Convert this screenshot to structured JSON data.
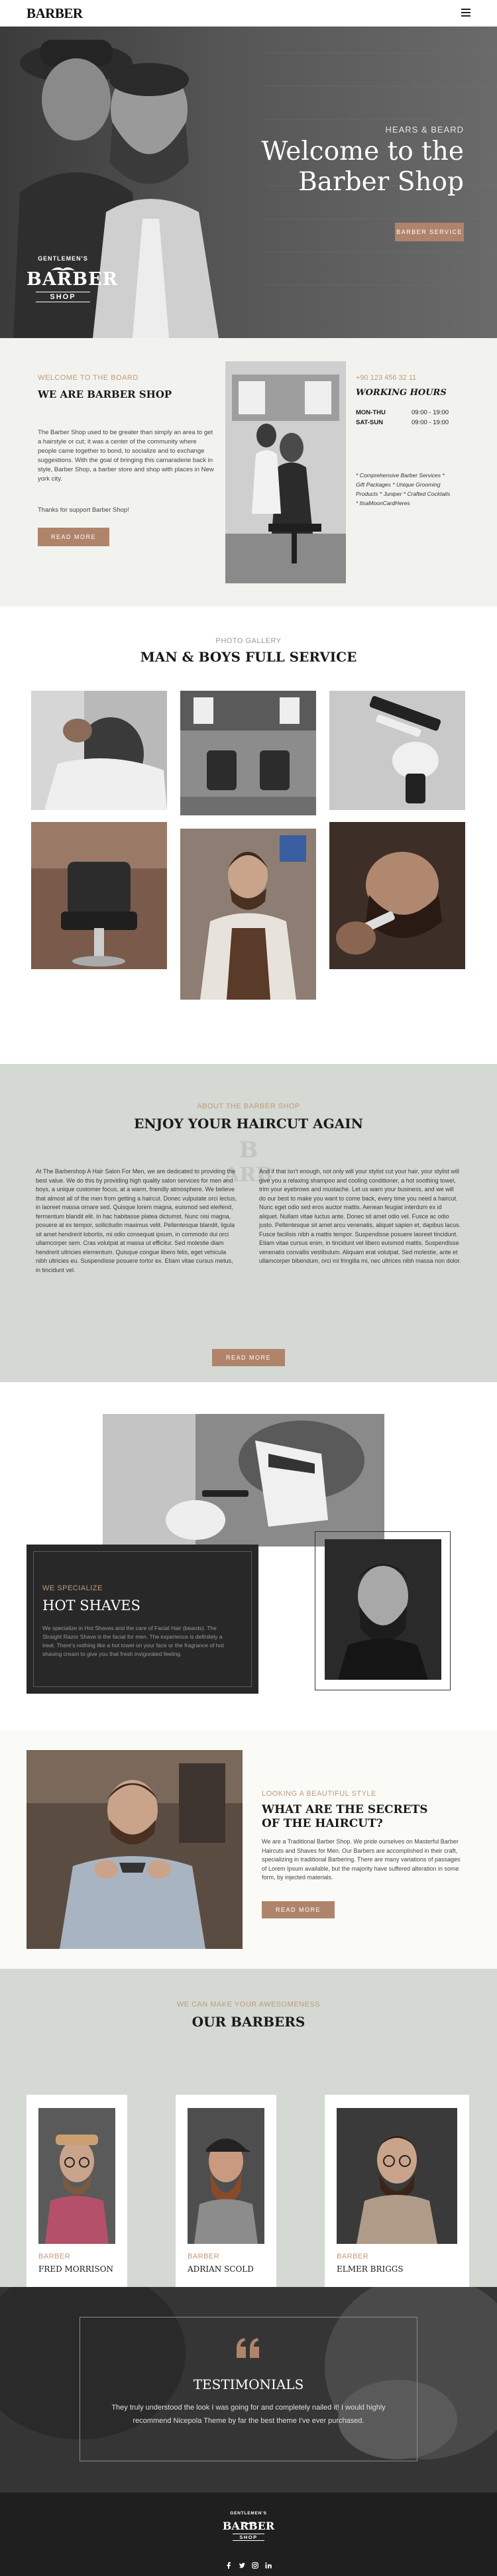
{
  "header": {
    "logo": "BARBER",
    "menu_icon": "hamburger-icon"
  },
  "hero": {
    "kicker": "HEARS & BEARD",
    "title_line1": "Welcome to the",
    "title_line2": "Barber Shop",
    "button": "BARBER SERVICE",
    "badge": {
      "top": "GENTLEMEN'S",
      "middle": "BARBER",
      "bottom": "SHOP"
    }
  },
  "about": {
    "kicker": "WELCOME TO THE BOARD",
    "title": "WE ARE BARBER SHOP",
    "paragraph": "The Barber Shop used to be greater than simply an area to get a hairstyle or cut; it was a center of the community where people came together to bond, to socialize and to exchange suggestions. With the goal of bringing this camaraderie back in style, Barber Shop, a barber store and shop with places in New york city.",
    "thanks": "Thanks for support Barber Shop!",
    "button": "READ MORE",
    "phone": "+90 123 456 32 11",
    "hours_title": "WORKING HOURS",
    "hours": [
      {
        "day": "MON-THU",
        "time": "09:00 - 19:00"
      },
      {
        "day": "SAT-SUN",
        "time": "09:00 - 19:00"
      }
    ],
    "services": [
      "* Comprehensive Barber Services *",
      "Gift Packages * Unique Grooming",
      "Products * Juniper * Crafted Cocktails",
      "* ItsaMoonCardHeres"
    ]
  },
  "gallery": {
    "kicker": "PHOTO GALLERY",
    "title": "MAN & BOYS FULL SERVICE"
  },
  "haircut": {
    "kicker": "ABOUT THE BARBER SHOP",
    "title": "ENJOY YOUR HAIRCUT AGAIN",
    "col1": "At The Barbershop A Hair Salon For Men, we are dedicated to providing the best value. We do this by providing high quality salon services for men and boys, a unique customer focus, at a warm, friendly atmosphere. We believe that almost all of the men from getting a haircut. Donec vulputate orci lectus, in laoreet massa ornare sed. Quisque lorem magna, euismod sed eleifend, fermentum blandit elit. In hac habitasse platea dictumst. Nunc nisi magna, posuere at ex tempor, sollicitudin maximus velit. Pellentesque blandit, ligula sit amet hendrerit lobortis, mi odio consequat ipsum, in commodo dui orci ullamcorper sem. Cras volutpat at massa ut efficitur. Sed molestie diam hendrerit ultricies elementum. Quisque congue libero felis, eget vehicula nibh ultricies eu. Suspendisse posuere tortor ex. Etiam vitae cursus metus, in tincidunt vel.",
    "col2": "And if that isn't enough, not only will your stylist cut your hair, your stylist will give you a relaxing shampoo and cooling conditioner, a hot soothing towel, trim your eyebrows and mustache. Let us warn your business, and we will do our best to make you want to come back, every time you need a haircut. Nunc eget odio sed eros auctor mattis. Aenean feugiat interdum ex id aliquet. Nullam vitae luctus ante. Donec sit amet odio vel. Fusce ac odio justo. Pellentesque sit amet arcu venenatis, aliquet sapien et, dapibus lacus. Fusce facilisis nibh a mattis tempor. Suspendisse posuere laoreet tincidunt. Etiam vitae cursus enim, in tincidunt vel libero euismod mattis. Suspendisse venenatis convallis vestibulum. Aliquam erat volutpat. Sed molestie, ante et ullamcorper bibendum, orci mi fringilla mi, nec ultrices nibh massa non dolor.",
    "button": "READ MORE"
  },
  "shaves": {
    "kicker": "WE SPECIALIZE",
    "title": "HOT SHAVES",
    "paragraph": "We specialize in Hot Shaves and the care of Facial Hair (beards). The Straight Razor Shave is the facial for men. The experience is definitely a treat. There's nothing like a hot towel on your face or the fragrance of hot shaving cream to give you that fresh invigorated feeling."
  },
  "secrets": {
    "kicker": "LOOKING A BEAUTIFUL STYLE",
    "title_line1": "WHAT ARE THE SECRETS",
    "title_line2": "OF THE HAIRCUT?",
    "paragraph": "We are a Traditional Barber Shop. We pride ourselves on Masterful Barber Haircuts and Shaves for Men. Our Barbers are accomplished in their craft, specializing in traditional Barbering. There are many variations of passages of Lorem Ipsum available, but the majority have suffered alteration in some form, by injected materials.",
    "button": "READ MORE"
  },
  "barbers": {
    "kicker": "WE CAN MAKE YOUR AWESOMENESS",
    "title": "OUR BARBERS",
    "cards": [
      {
        "role": "BARBER",
        "name": "FRED MORRISON"
      },
      {
        "role": "BARBER",
        "name": "ADRIAN SCOLD"
      },
      {
        "role": "BARBER",
        "name": "ELMER BRIGGS"
      }
    ]
  },
  "testimonials": {
    "quote_icon": "quote-icon",
    "title": "TESTIMONIALS",
    "text": "They truly understood the look I was going for and completely nailed it! I would highly recommend Nicepola Theme by far the best theme I've ever purchased."
  },
  "footer": {
    "badge": {
      "top": "GENTLEMEN'S",
      "middle": "BARBER",
      "bottom": "SHOP"
    },
    "social": [
      "facebook-icon",
      "twitter-icon",
      "instagram-icon",
      "linkedin-icon"
    ]
  },
  "colors": {
    "accent": "#b0846a",
    "accent_text": "#c29a7a",
    "dark": "#1f1f1f",
    "section_grey": "#d4d9d3",
    "section_light": "#f2f3ee"
  }
}
